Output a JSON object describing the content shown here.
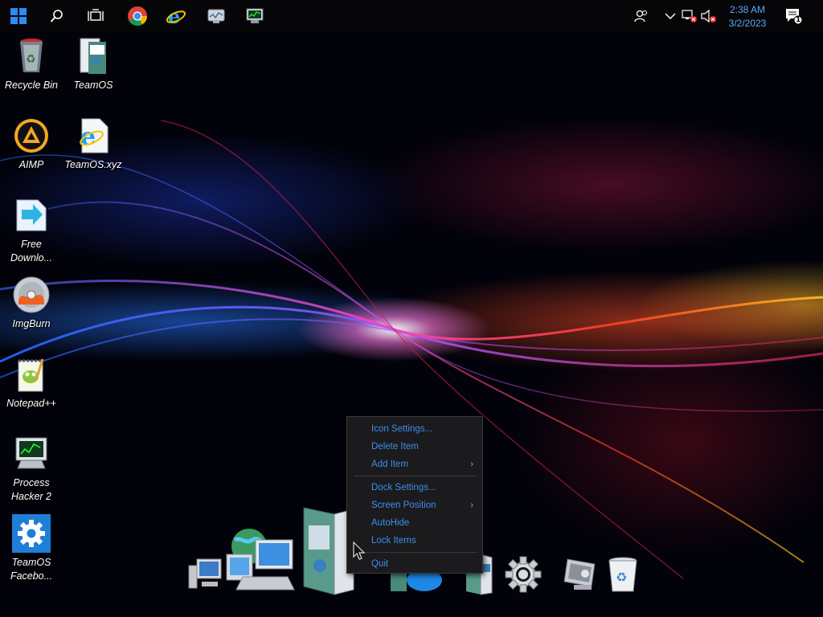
{
  "taskbar": {
    "start_icon": "windows-logo-icon",
    "search_icon": "search-icon",
    "task_view_icon": "task-view-icon",
    "pinned": [
      "chrome-icon",
      "internet-explorer-icon",
      "system-monitor-icon",
      "process-hacker-icon"
    ],
    "tray": [
      "people-icon",
      "chevron-up-icon",
      "network-icon",
      "volume-muted-icon"
    ],
    "time": "2:38 AM",
    "date": "3/2/2023",
    "notification_icon": "action-center-icon",
    "notification_count": "1"
  },
  "desktop": {
    "icons": [
      {
        "label": "Recycle Bin"
      },
      {
        "label": "TeamOS"
      },
      {
        "label": "AIMP"
      },
      {
        "label": "TeamOS.xyz"
      },
      {
        "label": "Free Downlo..."
      },
      {
        "label": "ImgBurn"
      },
      {
        "label": "Notepad++"
      },
      {
        "label": "Process Hacker 2"
      },
      {
        "label": "TeamOS Facebo..."
      }
    ]
  },
  "dock": {
    "items": [
      "computer-icon",
      "network-globe-icon",
      "documents-icon",
      "media-icon",
      "folder-icon",
      "settings-gear-icon",
      "system-monitor-icon",
      "recycle-bin-icon"
    ]
  },
  "context_menu": {
    "icon_settings": "Icon Settings...",
    "delete_item": "Delete Item",
    "add_item": "Add Item",
    "dock_settings": "Dock Settings...",
    "screen_position": "Screen Position",
    "autohide": "AutoHide",
    "lock_items": "Lock Items",
    "quit": "Quit",
    "submenu_arrow": "›"
  },
  "colors": {
    "menu_text": "#3e8eea",
    "clock_text": "#5aa9ff",
    "menu_bg": "#1b1b1d",
    "taskbar_bg": "#060608"
  }
}
